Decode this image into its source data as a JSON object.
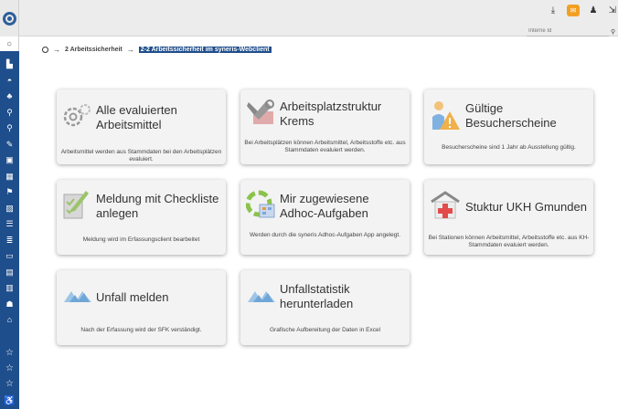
{
  "topbar": {
    "search_placeholder": "Interne Id"
  },
  "breadcrumb": {
    "items": [
      "2 Arbeitssicherheit",
      "2-2 Arbeitssicherheit im syneris-Webclient"
    ]
  },
  "tiles": [
    {
      "title": "Alle evaluierten Arbeitsmittel",
      "desc": "Arbeitsmittel werden aus Stammdaten bei den Arbeitsplätzen evaluiert."
    },
    {
      "title": "Arbeitsplatzstruktur Krems",
      "desc": "Bei Arbeitsplätzen können Arbeitsmittel, Arbeitsstoffe etc. aus Stammdaten evaluiert werden."
    },
    {
      "title": "Gültige Besucherscheine",
      "desc": "Besucherscheine sind 1 Jahr ab Ausstellung gültig."
    },
    {
      "title": "Meldung mit Checkliste anlegen",
      "desc": "Meldung wird im Erfassungsclient bearbeitet"
    },
    {
      "title": "Mir zugewiesene Adhoc-Aufgaben",
      "desc": "Werden durch die syneris Adhoc-Aufgaben App angelegt."
    },
    {
      "title": "Stuktur UKH Gmunden",
      "desc": "Bei Stationen können Arbeitsmittel, Arbeitsstoffe etc. aus KH-Stammdaten evaluiert werden."
    },
    {
      "title": "Unfall melden",
      "desc": "Nach der Erfassung wird der SFK verständigt."
    },
    {
      "title": "Unfallstatistik herunterladen",
      "desc": "Grafische Aufbereitung der Daten in Excel"
    }
  ],
  "colors": {
    "sidebar": "#1f4e8c",
    "accent_orange": "#f2a023"
  }
}
